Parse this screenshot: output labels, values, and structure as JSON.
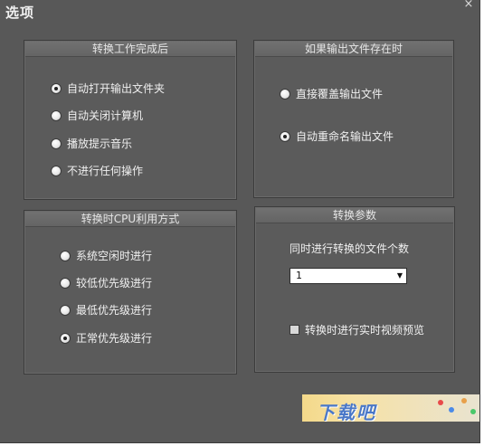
{
  "window": {
    "title": "选项",
    "close_glyph": "×"
  },
  "group_after_done": {
    "header": "转换工作完成后",
    "options": [
      {
        "label": "自动打开输出文件夹",
        "checked": true
      },
      {
        "label": "自动关闭计算机",
        "checked": false
      },
      {
        "label": "播放提示音乐",
        "checked": false
      },
      {
        "label": "不进行任何操作",
        "checked": false
      }
    ]
  },
  "group_file_exists": {
    "header": "如果输出文件存在时",
    "options": [
      {
        "label": "直接覆盖输出文件",
        "checked": false
      },
      {
        "label": "自动重命名输出文件",
        "checked": true
      }
    ]
  },
  "group_cpu": {
    "header": "转换时CPU利用方式",
    "options": [
      {
        "label": "系统空闲时进行",
        "checked": false
      },
      {
        "label": "较低优先级进行",
        "checked": false
      },
      {
        "label": "最低优先级进行",
        "checked": false
      },
      {
        "label": "正常优先级进行",
        "checked": true
      }
    ]
  },
  "group_params": {
    "header": "转换参数",
    "concurrent_label": "同时进行转换的文件个数",
    "concurrent_value": "1",
    "preview_label": "转换时进行实时视频预览",
    "preview_checked": false
  },
  "colors": {
    "dialog_bg": "#585858",
    "watermark_text": "#4a78c8"
  }
}
